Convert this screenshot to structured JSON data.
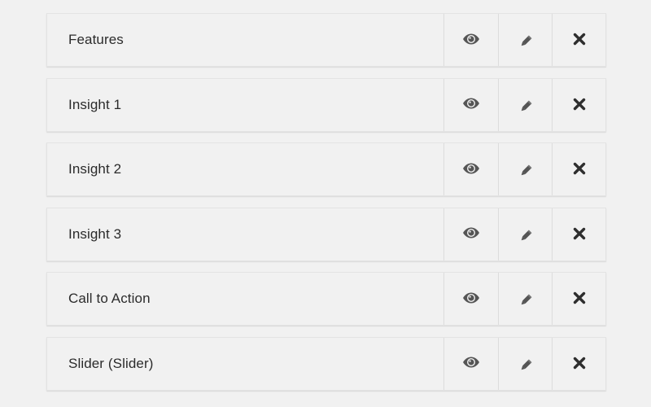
{
  "items": [
    {
      "label": "Features"
    },
    {
      "label": "Insight 1"
    },
    {
      "label": "Insight 2"
    },
    {
      "label": "Insight 3"
    },
    {
      "label": "Call to Action"
    },
    {
      "label": "Slider (Slider)"
    }
  ],
  "icons": {
    "view": "eye-icon",
    "edit": "pencil-icon",
    "remove": "close-icon"
  },
  "colors": {
    "background": "#f1f1f1",
    "icon": "#555555",
    "text": "#2b2b2b"
  }
}
